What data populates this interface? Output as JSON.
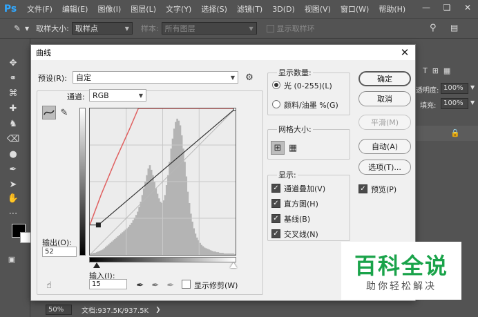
{
  "app": {
    "logo": "Ps",
    "menu": [
      "文件(F)",
      "编辑(E)",
      "图像(I)",
      "图层(L)",
      "文字(Y)",
      "选择(S)",
      "滤镜(T)",
      "3D(D)",
      "视图(V)",
      "窗口(W)",
      "帮助(H)"
    ],
    "window_controls": [
      "minimize-icon",
      "restore-icon",
      "close-icon"
    ]
  },
  "options_bar": {
    "sample_size_label": "取样大小:",
    "sample_size_value": "取样点",
    "sample_label": "样本:",
    "sample_value": "所有图层",
    "show_ring_label": "显示取样环"
  },
  "right_panel": {
    "opacity_label": "透明度:",
    "opacity_value": "100%",
    "fill_label": "填充:",
    "fill_value": "100%"
  },
  "status_bar": {
    "zoom": "50%",
    "doc_info": "文档:937.5K/937.5K"
  },
  "dialog": {
    "title": "曲线",
    "preset_label": "预设(R):",
    "preset_value": "自定",
    "channel_label": "通道:",
    "channel_value": "RGB",
    "output_label": "输出(O):",
    "output_value": "52",
    "input_label": "输入(I):",
    "input_value": "15",
    "show_clipping_label": "显示修剪(W)",
    "display_amount": {
      "title": "显示数量:",
      "options": [
        "光 (0-255)(L)",
        "颜料/油墨 %(G)"
      ],
      "selected": 0
    },
    "grid_size": {
      "title": "网格大小:"
    },
    "show": {
      "title": "显示:",
      "options": [
        {
          "label": "通道叠加(V)",
          "checked": true
        },
        {
          "label": "直方图(H)",
          "checked": true
        },
        {
          "label": "基线(B)",
          "checked": true
        },
        {
          "label": "交叉线(N)",
          "checked": true
        }
      ]
    },
    "buttons": {
      "ok": "确定",
      "cancel": "取消",
      "smooth": "平滑(M)",
      "auto": "自动(A)",
      "options": "选项(T)..."
    },
    "preview": {
      "label": "预览(P)",
      "checked": true
    },
    "colors": {
      "curve": "#333333",
      "red_overlay": "#e06060",
      "histogram": "#b4b4b4"
    }
  },
  "watermark": {
    "main": "百科全说",
    "sub": "助你轻松解决"
  },
  "chart_data": {
    "type": "line",
    "xlim": [
      0,
      255
    ],
    "ylim": [
      0,
      255
    ],
    "grid": "4x4",
    "series": [
      {
        "points": [
          [
            15,
            52
          ],
          [
            255,
            255
          ]
        ]
      },
      {
        "points": [
          [
            0,
            52
          ],
          [
            20,
            105
          ],
          [
            45,
            165
          ],
          [
            70,
            220
          ],
          [
            85,
            255
          ],
          [
            255,
            255
          ]
        ]
      }
    ],
    "histogram": [
      2,
      2,
      3,
      3,
      4,
      5,
      6,
      7,
      8,
      10,
      12,
      14,
      16,
      18,
      20,
      22,
      24,
      26,
      28,
      30,
      32,
      34,
      36,
      38,
      40,
      42,
      45,
      48,
      52,
      56,
      60,
      65,
      72,
      80,
      90,
      100,
      110,
      120,
      130,
      135,
      128,
      120,
      110,
      100,
      92,
      85,
      80,
      78,
      82,
      90,
      105,
      120,
      140,
      160,
      175,
      190,
      200,
      205,
      202,
      195,
      180,
      160,
      140,
      118,
      95,
      78,
      62,
      50,
      40,
      32,
      26,
      22,
      18,
      15,
      13,
      11,
      10,
      9,
      8,
      7,
      6,
      5,
      5,
      4,
      4,
      3,
      3,
      3,
      2,
      2,
      2,
      2,
      2,
      2,
      2,
      1
    ]
  }
}
